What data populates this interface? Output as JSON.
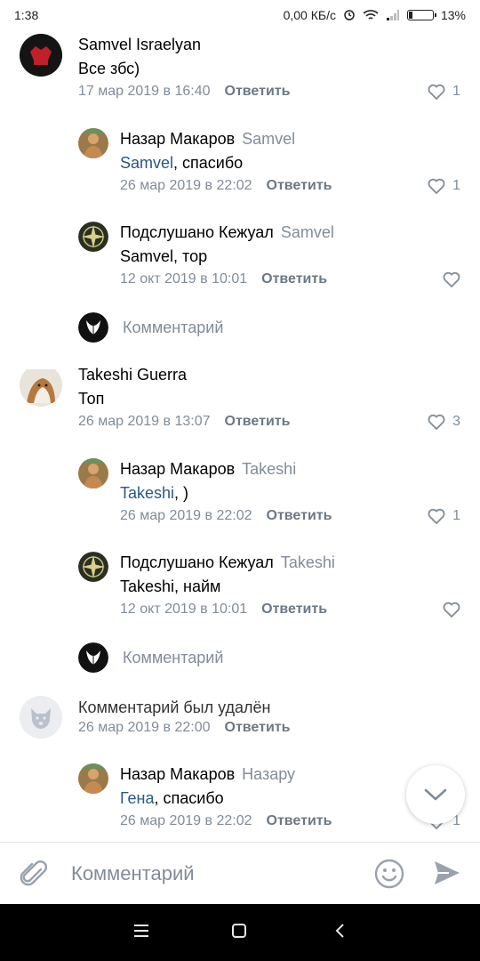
{
  "status_bar": {
    "time": "1:38",
    "speed": "0,00 КБ/с",
    "battery": "13%",
    "battery_level": 0.13
  },
  "reply_label": "Ответить",
  "comment_placeholder": "Комментарий",
  "comments": [
    {
      "author": "Samvel Israelyan",
      "text": "Все збс)",
      "date": "17 мар 2019 в 16:40",
      "likes": "1",
      "avatar": "logo-avatar"
    },
    {
      "author": "Назар Макаров",
      "reply_to": "Samvel",
      "mention": "Samvel",
      "text_rest": ", спасибо",
      "date": "26 мар 2019 в 22:02",
      "likes": "1",
      "avatar": "photo-avatar"
    },
    {
      "author": "Подслушано Кежуал",
      "reply_to": "Samvel",
      "text": "Samvel, тор",
      "date": "12 окт 2019 в 10:01",
      "likes": "",
      "avatar": "compass-avatar"
    },
    {
      "author": "Takeshi Guerra",
      "text": "Топ",
      "date": "26 мар 2019 в 13:07",
      "likes": "3",
      "avatar": "dog-avatar"
    },
    {
      "author": "Назар Макаров",
      "reply_to": "Takeshi",
      "mention": "Takeshi",
      "text_rest": ", )",
      "date": "26 мар 2019 в 22:02",
      "likes": "1",
      "avatar": "photo-avatar"
    },
    {
      "author": "Подслушано Кежуал",
      "reply_to": "Takeshi",
      "text": "Takeshi, найм",
      "date": "12 окт 2019 в 10:01",
      "likes": "",
      "avatar": "compass-avatar"
    },
    {
      "deleted_text": "Комментарий был удалён",
      "date": "26 мар 2019 в 22:00",
      "avatar": "deleted-dog-avatar"
    },
    {
      "author": "Назар Макаров",
      "reply_to": "Назару",
      "mention": "Гена",
      "text_rest": ", спасибо",
      "date": "26 мар 2019 в 22:02",
      "likes": "1",
      "avatar": "photo-avatar"
    }
  ],
  "composer": {
    "placeholder": "Комментарий"
  },
  "colors": {
    "link": "#2a5885",
    "secondary": "#818c99",
    "send": "#99a2ad"
  }
}
